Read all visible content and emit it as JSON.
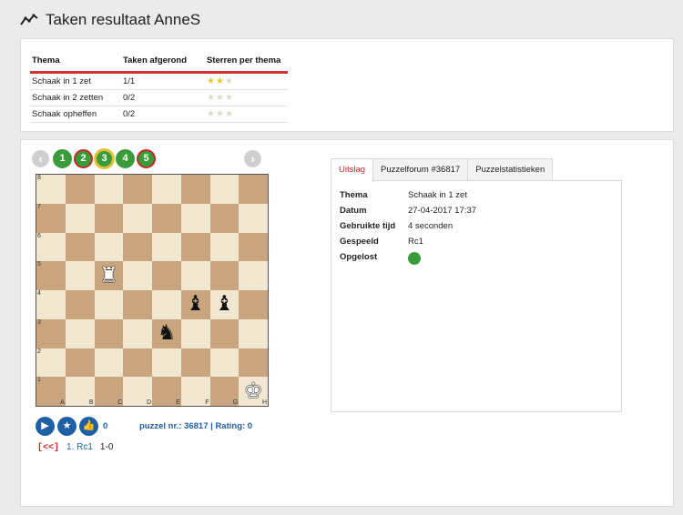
{
  "page": {
    "title": "Taken resultaat AnneS"
  },
  "summary": {
    "headers": [
      "Thema",
      "Taken afgerond",
      "Sterren per thema"
    ],
    "rows": [
      {
        "theme": "Schaak in 1 zet",
        "completed": "1/1",
        "stars": 2,
        "max_stars": 3
      },
      {
        "theme": "Schaak in 2 zetten",
        "completed": "0/2",
        "stars": 0,
        "max_stars": 3
      },
      {
        "theme": "Schaak opheffen",
        "completed": "0/2",
        "stars": 0,
        "max_stars": 3
      }
    ]
  },
  "puzzle_nav": {
    "prev": "‹",
    "next": "›",
    "buttons": [
      {
        "label": "1",
        "status": "green"
      },
      {
        "label": "2",
        "status": "red"
      },
      {
        "label": "3",
        "status": "current"
      },
      {
        "label": "4",
        "status": "green"
      },
      {
        "label": "5",
        "status": "red"
      }
    ]
  },
  "board": {
    "files": [
      "A",
      "B",
      "C",
      "D",
      "E",
      "F",
      "G",
      "H"
    ],
    "ranks": [
      "8",
      "7",
      "6",
      "5",
      "4",
      "3",
      "2",
      "1"
    ],
    "pieces": [
      {
        "square": "c5",
        "glyph": "♜",
        "color": "white",
        "name": "white-rook"
      },
      {
        "square": "f4",
        "glyph": "♝",
        "color": "black",
        "name": "black-bishop"
      },
      {
        "square": "g4",
        "glyph": "♝",
        "color": "black",
        "name": "black-bishop"
      },
      {
        "square": "e3",
        "glyph": "♞",
        "color": "black",
        "name": "black-knight"
      },
      {
        "square": "h1",
        "glyph": "♚",
        "color": "white",
        "name": "white-king"
      }
    ]
  },
  "controls": {
    "play_icon": "play-icon",
    "star_icon": "star-icon",
    "like_icon": "thumbs-up-icon",
    "like_count": "0",
    "puzzle_info": "puzzel nr.: 36817 | Rating: 0"
  },
  "moves": {
    "back_link": "[<<]",
    "move": "1. Rc1",
    "result": "1-0"
  },
  "tabs": [
    "Uitslag",
    "Puzzelforum #36817",
    "Puzzelstatistieken"
  ],
  "details": {
    "rows": [
      {
        "key": "Thema",
        "value": "Schaak in 1 zet"
      },
      {
        "key": "Datum",
        "value": "27-04-2017 17:37"
      },
      {
        "key": "Gebruikte tijd",
        "value": "4 seconden"
      },
      {
        "key": "Gespeeld",
        "value": "Rc1"
      },
      {
        "key": "Opgelost",
        "value": ""
      }
    ]
  },
  "colors": {
    "accent_red": "#c62828",
    "solved_green": "#3a9b3a",
    "link_blue": "#1f5fa6"
  }
}
